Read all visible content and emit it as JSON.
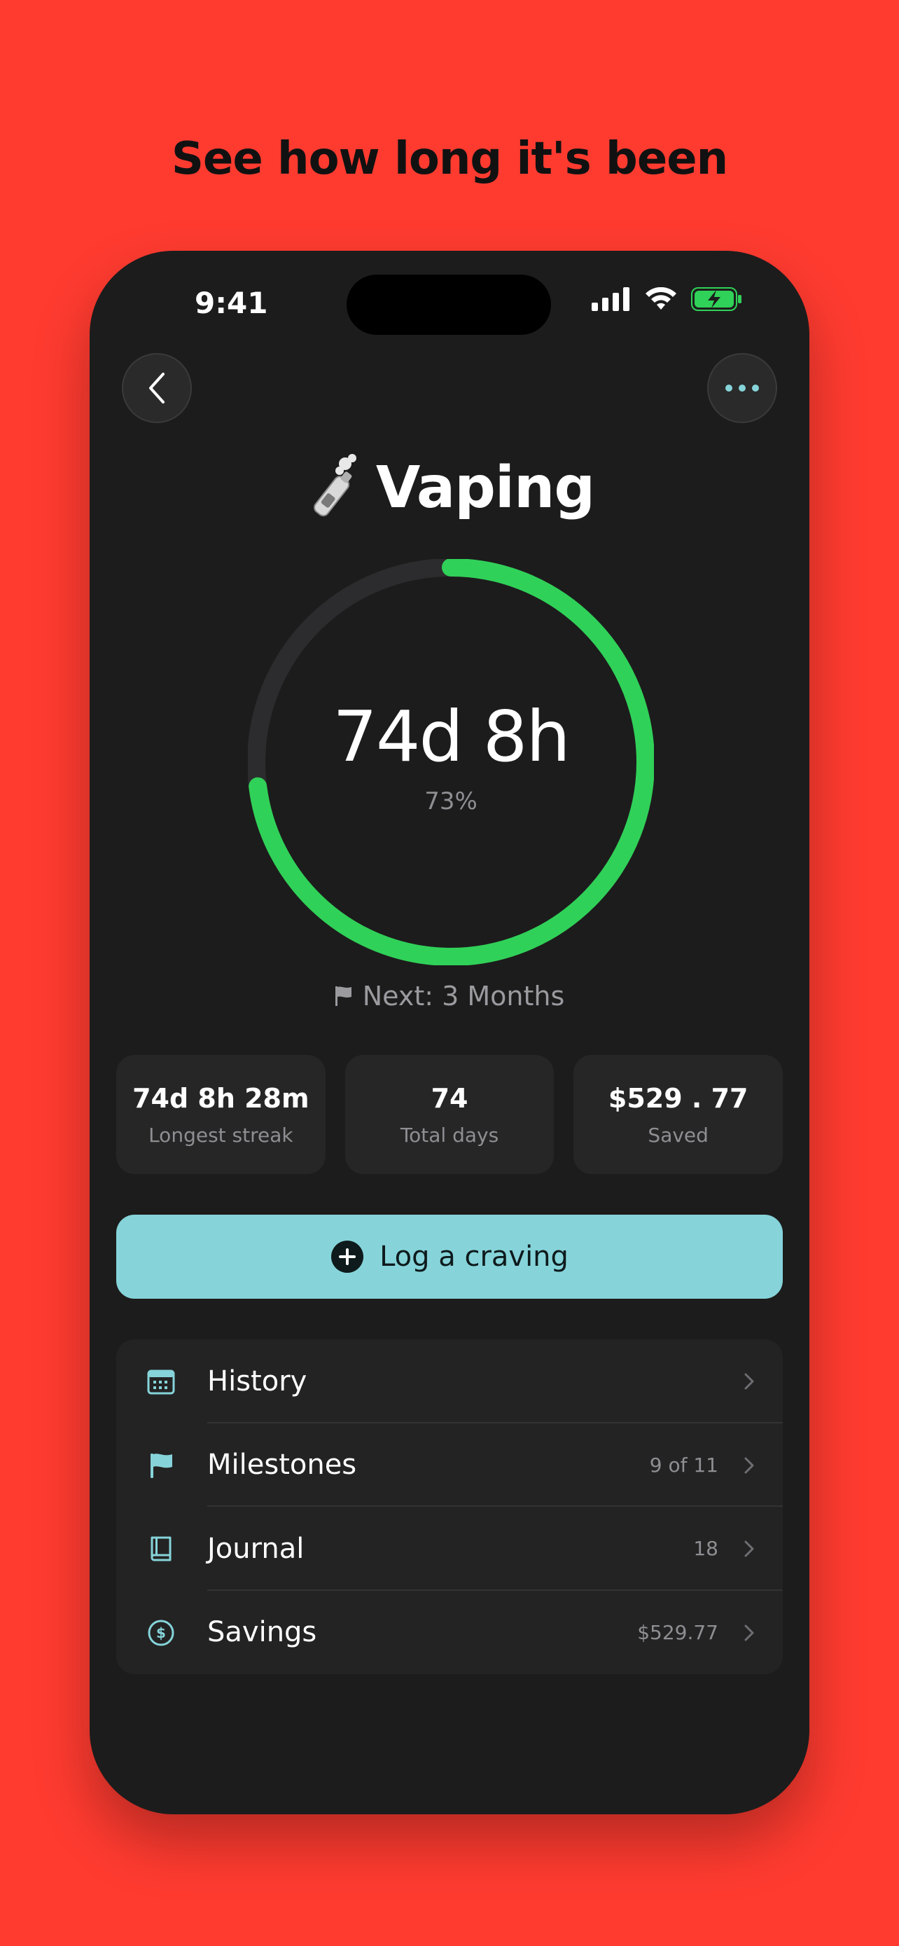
{
  "headline": "See how long it's been",
  "status": {
    "time": "9:41"
  },
  "header": {
    "title": "Vaping",
    "emoji": "🚬"
  },
  "progress": {
    "value_text": "74d 8h",
    "percent_text": "73%",
    "fraction": 0.73,
    "track_color": "#2C2C2E",
    "fill_color": "#30D158"
  },
  "next": {
    "label": "Next: 3 Months"
  },
  "stats": [
    {
      "value": "74d 8h 28m",
      "label": "Longest streak"
    },
    {
      "value": "74",
      "label": "Total days"
    },
    {
      "value": "$529 . 77",
      "label": "Saved"
    }
  ],
  "cta": {
    "label": "Log a craving"
  },
  "menu": [
    {
      "label": "History",
      "detail": "",
      "icon": "calendar-icon"
    },
    {
      "label": "Milestones",
      "detail": "9 of 11",
      "icon": "flag-icon"
    },
    {
      "label": "Journal",
      "detail": "18",
      "icon": "book-icon"
    },
    {
      "label": "Savings",
      "detail": "$529.77",
      "icon": "dollar-icon"
    }
  ],
  "colors": {
    "background": "#FF3B30",
    "phone": "#1C1C1C",
    "accent": "#86D4DA",
    "green": "#30D158"
  }
}
